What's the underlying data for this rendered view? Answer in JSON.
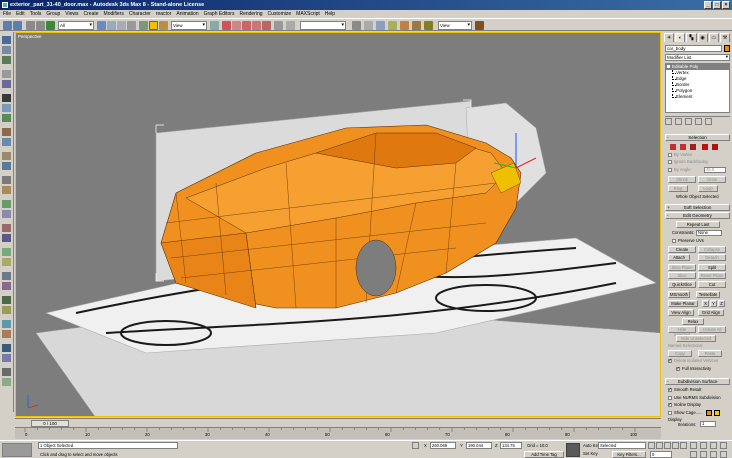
{
  "window": {
    "title": "exterior_part_31-40_door.max - Autodesk 3ds Max 8 - Stand-alone License",
    "controls": [
      "_",
      "□",
      "×"
    ]
  },
  "menu": [
    "File",
    "Edit",
    "Tools",
    "Group",
    "Views",
    "Create",
    "Modifiers",
    "Character",
    "reactor",
    "Animation",
    "Graph Editors",
    "Rendering",
    "Customize",
    "MAXScript",
    "Help"
  ],
  "toolbar": {
    "selection_filter": "All",
    "reference_coord": "View",
    "named_selection": "",
    "render_view": "View"
  },
  "viewport": {
    "label": "Perspective"
  },
  "command_panel": {
    "object_name": "car_body",
    "modifier_list": "Modifier List",
    "stack": {
      "selected": "Editable Poly",
      "subobjects": [
        "Vertex",
        "Edge",
        "Border",
        "Polygon",
        "Element"
      ]
    },
    "selection_rollout": {
      "title": "Selection",
      "by_vertex": "By Vertex",
      "ignore_backfacing": "Ignore Backfacing",
      "by_angle": "By Angle:",
      "by_angle_value": "45.0",
      "shrink": "Shrink",
      "grow": "Grow",
      "ring": "Ring",
      "loop": "Loop",
      "status": "Whole Object Selected"
    },
    "soft_selection": "Soft Selection",
    "edit_geometry": {
      "title": "Edit Geometry",
      "repeat_last": "Repeat Last",
      "constraints_label": "Constraints:",
      "constraints_value": "None",
      "preserve_uvs": "Preserve UVs",
      "create": "Create",
      "collapse": "Collapse",
      "attach": "Attach",
      "detach": "Detach",
      "slice_plane": "Slice Plane",
      "split": "Split",
      "slice": "Slice",
      "reset_plane": "Reset Plane",
      "quickslice": "QuickSlice",
      "cut": "Cut",
      "msmooth": "MSmooth",
      "tessellate": "Tessellate",
      "make_planar": "Make Planar",
      "x": "X",
      "y": "Y",
      "z": "Z",
      "view_align": "View Align",
      "grid_align": "Grid Align",
      "relax": "Relax",
      "hide_selected": "Hide Selected",
      "unhide_all": "Unhide All",
      "hide_unselected": "Hide Unselected",
      "named_selections": "Named Selections:",
      "copy": "Copy",
      "paste": "Paste",
      "delete_isolated": "Delete Isolated Vertices",
      "full_interactivity": "Full Interactivity"
    },
    "subdivision_surface": {
      "title": "Subdivision Surface",
      "smooth_result": "Smooth Result",
      "use_nurms": "Use NURMS Subdivision",
      "isoline_display": "Isoline Display",
      "show_cage": "Show Cage......",
      "display": "Display",
      "iterations_label": "Iterations:",
      "iterations_value": "1",
      "smoothness_label": "Smoothness:",
      "smoothness_value": "1.0"
    }
  },
  "timeslider": {
    "position": "0 / 100",
    "ticks": [
      "0",
      "10",
      "20",
      "30",
      "40",
      "50",
      "60",
      "70",
      "80",
      "90",
      "100"
    ]
  },
  "status": {
    "selected": "1 Object Selected",
    "prompt": "Click and drag to select and move objects",
    "x_label": "X",
    "x_value": "260.069",
    "y_label": "Y",
    "y_value": "190.044",
    "z_label": "Z",
    "z_value": "134.75",
    "grid": "Grid = 10.0",
    "add_time_tag": "Add Time Tag",
    "auto_key": "Auto Key",
    "set_key": "Set Key",
    "selected_dropdown": "Selected",
    "key_filters": "Key Filters...",
    "frame": "0"
  },
  "colors": {
    "car_body": "#f0901e",
    "viewport_bg": "#7d7d7d",
    "active_border": "#f0c000",
    "titlebar": "#0a246a"
  }
}
